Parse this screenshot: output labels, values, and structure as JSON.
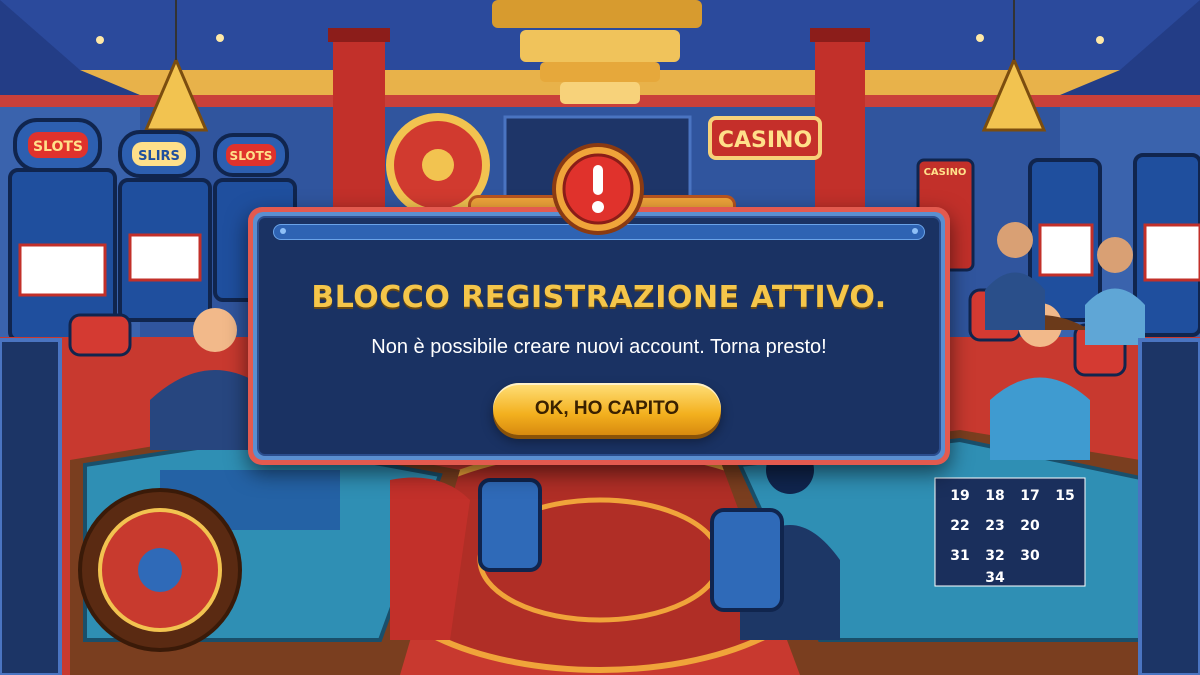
{
  "scene": {
    "signs": [
      "SLOTS",
      "SLIRS",
      "SLOTS",
      "CASINO",
      "CASINO"
    ],
    "table_numbers": [
      "19",
      "18",
      "17",
      "15",
      "22",
      "23",
      "20",
      "31",
      "32",
      "30",
      "34"
    ]
  },
  "dialog": {
    "title": "BLOCCO REGISTRAZIONE ATTIVO.",
    "message": "Non è possibile creare nuovi account. Torna presto!",
    "button_label": "OK, HO CAPITO",
    "icon": "warning-icon"
  },
  "colors": {
    "dialog_bg": "#1a3263",
    "title": "#f5c64a",
    "button": "#f3b01e",
    "alert": "#e0322c"
  }
}
